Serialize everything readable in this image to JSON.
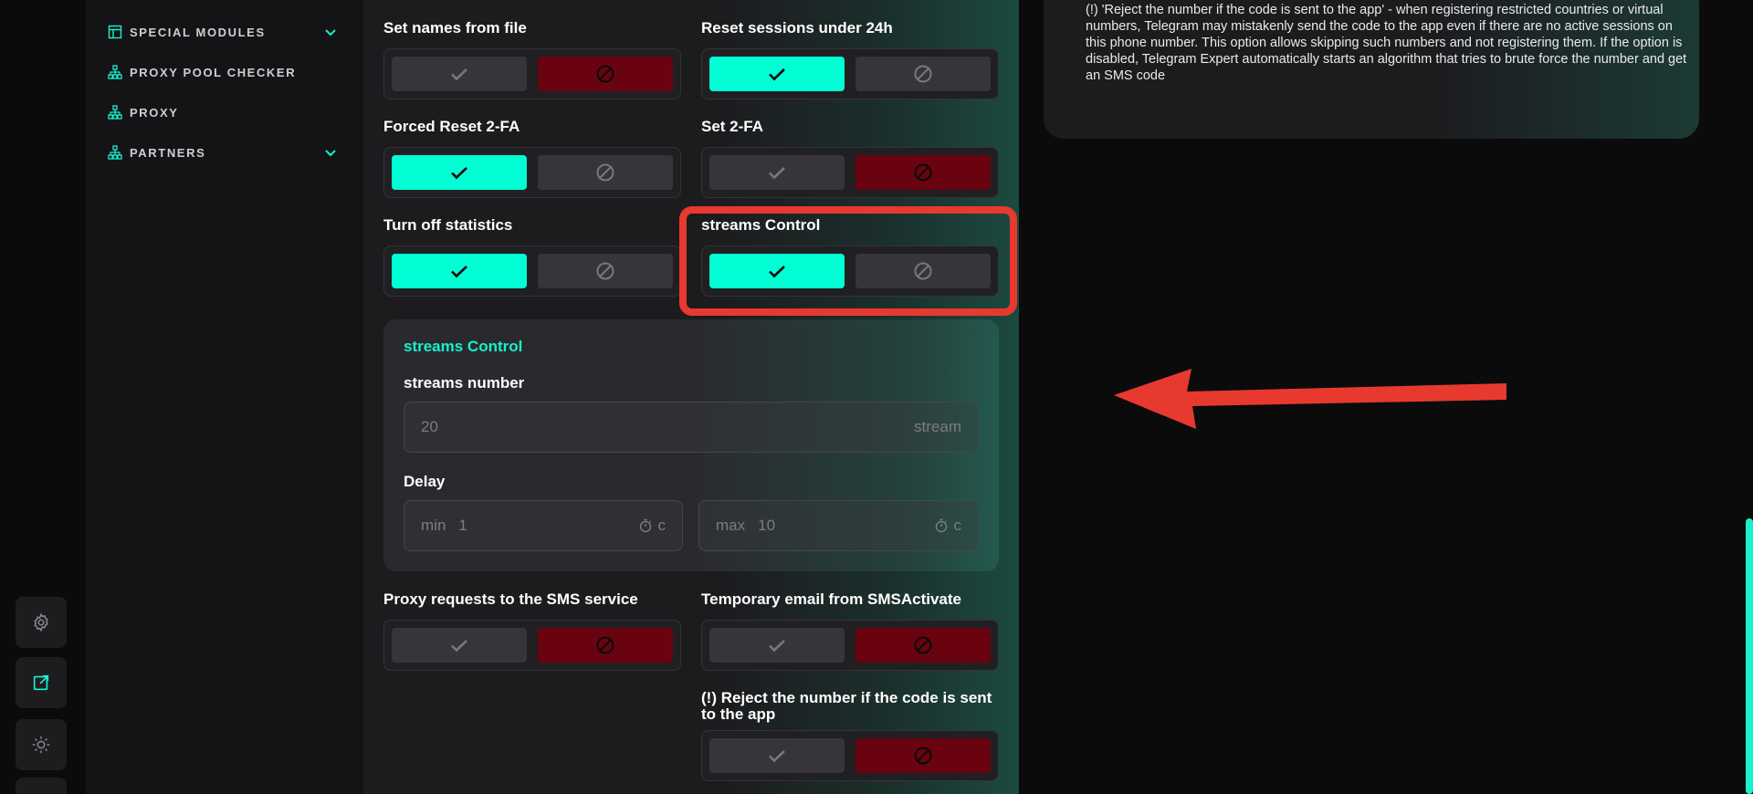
{
  "nav": {
    "items": [
      {
        "label": "SPECIAL MODULES",
        "icon": "table-icon",
        "expandable": true
      },
      {
        "label": "PROXY POOL CHECKER",
        "icon": "network-icon",
        "expandable": false
      },
      {
        "label": "PROXY",
        "icon": "network-icon",
        "expandable": false
      },
      {
        "label": "PARTNERS",
        "icon": "network-icon",
        "expandable": true
      }
    ]
  },
  "rail": {
    "buttons": [
      "gear-icon",
      "external-link-icon",
      "sun-icon"
    ]
  },
  "settings": [
    {
      "label": "Set names from file",
      "value": false
    },
    {
      "label": "Reset sessions under 24h",
      "value": true
    },
    {
      "label": "Forced Reset 2-FA",
      "value": true
    },
    {
      "label": "Set 2-FA",
      "value": false
    },
    {
      "label": "Turn off statistics",
      "value": true
    },
    {
      "label": "streams Control",
      "value": true
    },
    {
      "label": "Proxy requests to the SMS service",
      "value": false
    },
    {
      "label": "Temporary email from SMSActivate",
      "value": false
    },
    {
      "label": "(!) Reject the number if the code is sent to the app",
      "value": false
    }
  ],
  "streams": {
    "title": "streams Control",
    "number_label": "streams number",
    "number_placeholder": "20",
    "number_suffix": "stream",
    "delay_label": "Delay",
    "min_prefix": "min",
    "min_value": "1",
    "max_prefix": "max",
    "max_value": "10",
    "unit": "c"
  },
  "info": {
    "text": "(!) 'Reject the number if the code is sent to the app' - when registering restricted countries or virtual numbers, Telegram may mistakenly send the code to the app even if there are no active sessions on this phone number. This option allows skipping such numbers and not registering them. If the option is disabled, Telegram Expert automatically starts an algorithm that tries to brute force the number and get an SMS code"
  },
  "colors": {
    "accent": "#00ffd5",
    "danger": "#6a0310",
    "annotation": "#e8392f"
  }
}
